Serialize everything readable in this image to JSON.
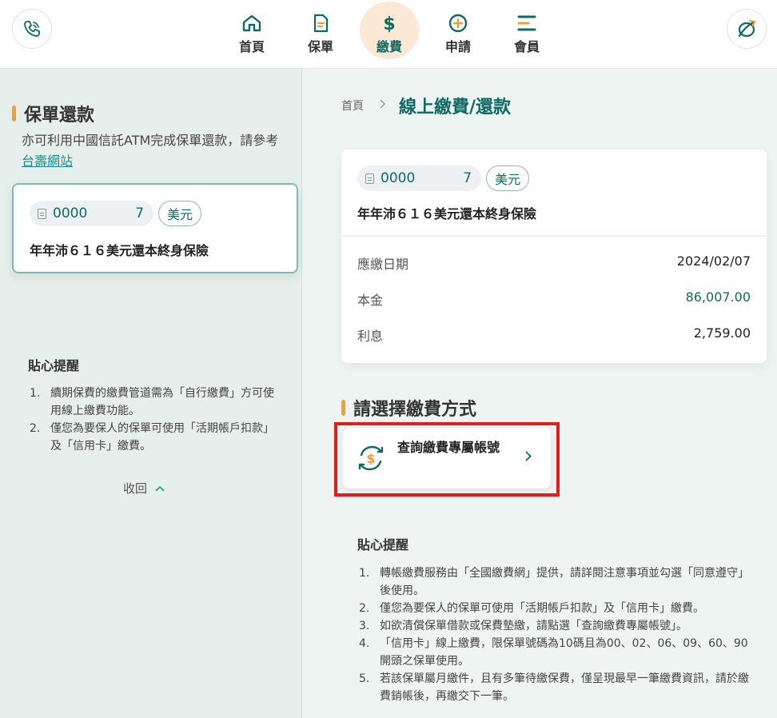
{
  "header": {
    "nav": [
      {
        "label": "首頁",
        "icon": "home-icon"
      },
      {
        "label": "保單",
        "icon": "policy-document-icon"
      },
      {
        "label": "繳費",
        "icon": "dollar-icon",
        "active": true
      },
      {
        "label": "申請",
        "icon": "plus-circle-icon"
      },
      {
        "label": "會員",
        "icon": "member-menu-icon"
      }
    ]
  },
  "left": {
    "title": "保單還款",
    "desc_text": "亦可利用中國信託ATM完成保單還款，請參考",
    "desc_link": "台壽網站",
    "policy": {
      "number_start": "0000",
      "number_end": "7",
      "currency": "美元",
      "name": "年年沛６１６美元還本終身保險"
    },
    "tips_title": "貼心提醒",
    "tips": [
      {
        "n": "1.",
        "text": "續期保費的繳費管道需為「自行繳費」方可使用線上繳費功能。"
      },
      {
        "n": "2.",
        "text": "僅您為要保人的保單可使用「活期帳戶扣款」及「信用卡」繳費。"
      }
    ],
    "collapse_label": "收回"
  },
  "right": {
    "breadcrumb": {
      "home": "首頁",
      "current": "線上繳費/還款"
    },
    "policy": {
      "number_start": "0000",
      "number_end": "7",
      "currency": "美元",
      "name": "年年沛６１６美元還本終身保險"
    },
    "details": [
      {
        "label": "應繳日期",
        "value": "2024/02/07"
      },
      {
        "label": "本金",
        "value": "86,007.00"
      },
      {
        "label": "利息",
        "value": "2,759.00"
      }
    ],
    "method_title": "請選擇繳費方式",
    "method_label": "查詢繳費專屬帳號",
    "tips_title": "貼心提醒",
    "tips": [
      {
        "n": "1.",
        "text": "轉帳繳費服務由「全國繳費網」提供，請詳閱注意事項並勾選「同意遵守」後使用。"
      },
      {
        "n": "2.",
        "text": "僅您為要保人的保單可使用「活期帳戶扣款」及「信用卡」繳費。"
      },
      {
        "n": "3.",
        "text": "如欲清償保單借款或保費墊繳，請點選「查詢繳費專屬帳號」。"
      },
      {
        "n": "4.",
        "text": "「信用卡」線上繳費，限保單號碼為10碼且為00、02、06、09、60、90開頭之保單使用。"
      },
      {
        "n": "5.",
        "text": "若該保單屬月繳件，且有多筆待繳保費，僅呈現最早一筆繳費資訊，請於繳費銷帳後，再繳交下一筆。"
      }
    ]
  },
  "colors": {
    "brand": "#0e6b63",
    "accent": "#f0a030",
    "highlight": "#e01e1e",
    "active_bg": "#fbe9d6"
  }
}
